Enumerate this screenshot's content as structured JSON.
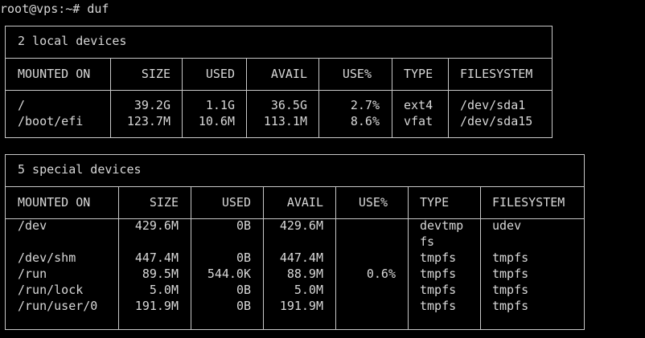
{
  "prompt": {
    "text": "root@vps:~# duf"
  },
  "tables": [
    {
      "title": "2 local devices",
      "headers": [
        "MOUNTED ON",
        "SIZE",
        "USED",
        "AVAIL",
        "USE%",
        "TYPE",
        "FILESYSTEM"
      ],
      "rows": [
        [
          "/",
          "39.2G",
          "1.1G",
          "36.5G",
          "2.7%",
          "ext4",
          "/dev/sda1"
        ],
        [
          "/boot/efi",
          "123.7M",
          "10.6M",
          "113.1M",
          "8.6%",
          "vfat",
          "/dev/sda15"
        ]
      ]
    },
    {
      "title": "5 special devices",
      "headers": [
        "MOUNTED ON",
        "SIZE",
        "USED",
        "AVAIL",
        "USE%",
        "TYPE",
        "FILESYSTEM"
      ],
      "rows": [
        [
          "/dev",
          "429.6M",
          "0B",
          "429.6M",
          "",
          "devtmp",
          "udev"
        ],
        [
          "",
          "",
          "",
          "",
          "",
          "fs",
          ""
        ],
        [
          "/dev/shm",
          "447.4M",
          "0B",
          "447.4M",
          "",
          "tmpfs",
          "tmpfs"
        ],
        [
          "/run",
          "89.5M",
          "544.0K",
          "88.9M",
          "0.6%",
          "tmpfs",
          "tmpfs"
        ],
        [
          "/run/lock",
          "5.0M",
          "0B",
          "5.0M",
          "",
          "tmpfs",
          "tmpfs"
        ],
        [
          "/run/user/0",
          "191.9M",
          "0B",
          "191.9M",
          "",
          "tmpfs",
          "tmpfs"
        ]
      ]
    }
  ],
  "colors": {
    "background": "#000000",
    "text": "#d8d8d8",
    "border": "#c8c8c8"
  }
}
